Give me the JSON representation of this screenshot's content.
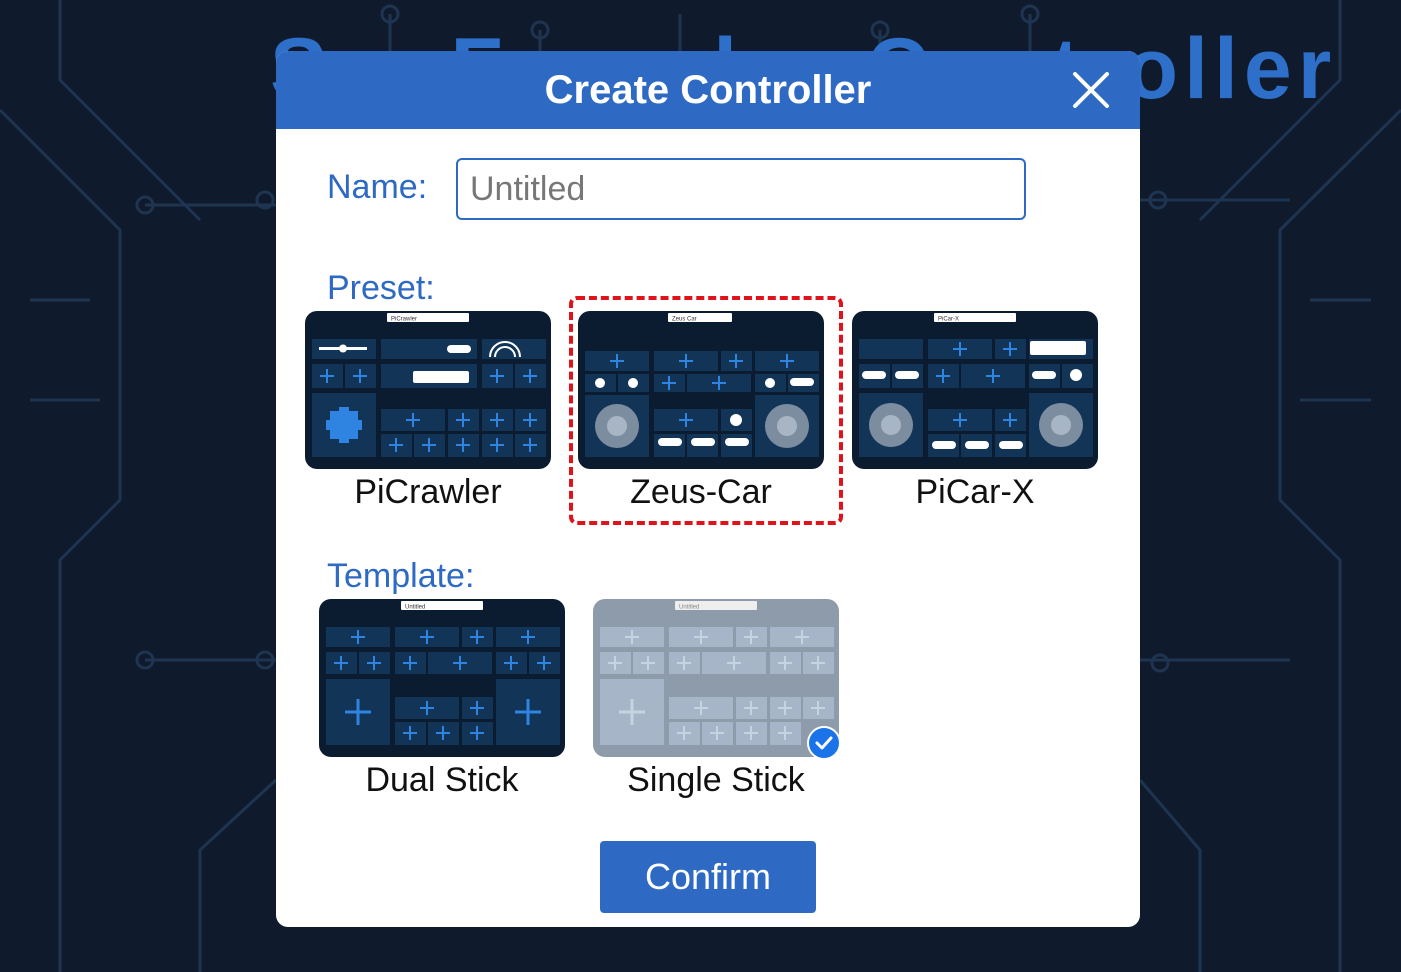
{
  "background": {
    "title": "SunFounder Controller"
  },
  "dialog": {
    "title": "Create Controller",
    "close_icon": "close-icon",
    "name_label": "Name:",
    "name_placeholder": "Untitled",
    "name_value": "",
    "preset_label": "Preset:",
    "presets": [
      {
        "name": "PiCrawler",
        "thumb_title": "PiCrawler"
      },
      {
        "name": "Zeus-Car",
        "thumb_title": "Zeus Car"
      },
      {
        "name": "PiCar-X",
        "thumb_title": "PiCar-X"
      }
    ],
    "selected_preset": "Zeus-Car",
    "template_label": "Template:",
    "templates": [
      {
        "name": "Dual Stick",
        "thumb_title": "Untitled"
      },
      {
        "name": "Single Stick",
        "thumb_title": "Untitled"
      }
    ],
    "selected_template": "Single Stick",
    "confirm_label": "Confirm"
  },
  "colors": {
    "accent": "#2e6ac3",
    "background": "#0f1b2c",
    "selection_border": "#e0131b",
    "check": "#1a73e8"
  }
}
